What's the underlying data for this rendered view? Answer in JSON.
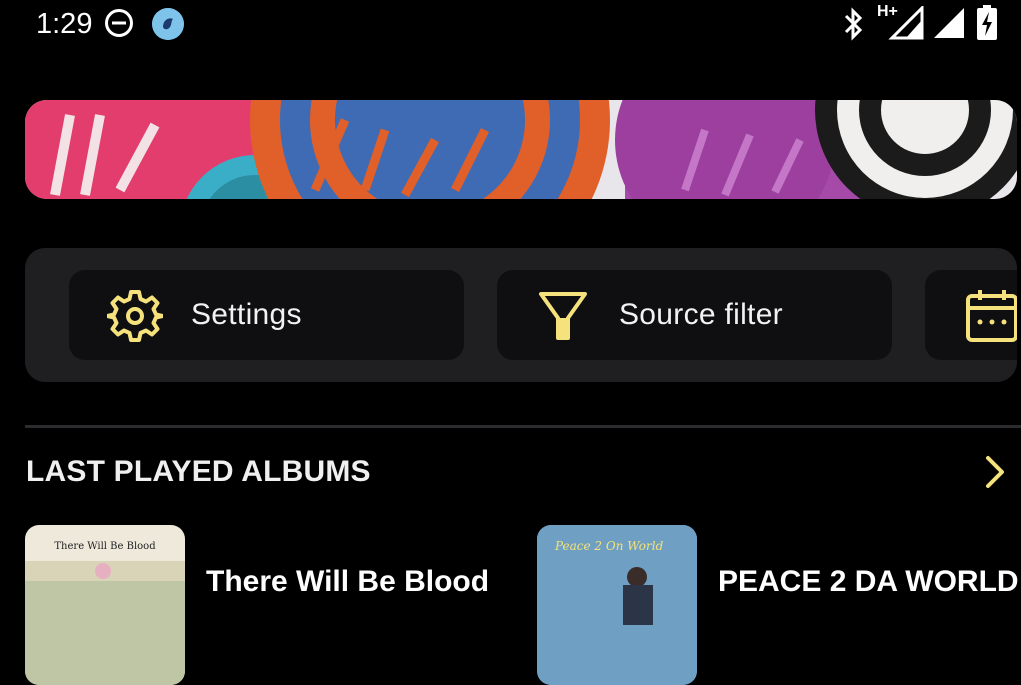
{
  "status_bar": {
    "time": "1:29",
    "network_type": "H+",
    "icons": [
      "do-not-disturb-icon",
      "app-notification-icon",
      "bluetooth-icon",
      "cell-signal-icon",
      "wifi-signal-icon",
      "battery-charging-icon"
    ]
  },
  "banner": {
    "icon": "collage-banner"
  },
  "shortcuts": {
    "settings_label": "Settings",
    "source_filter_label": "Source filter",
    "icons": [
      "gear-icon",
      "filter-icon",
      "calendar-icon"
    ]
  },
  "last_played": {
    "title": "LAST PLAYED ALBUMS",
    "albums": [
      {
        "title": "There Will Be Blood",
        "cover_text": "There Will Be Blood"
      },
      {
        "title": "PEACE 2 DA WORLD",
        "cover_text": "Peace 2 On World"
      }
    ]
  },
  "colors": {
    "accent": "#f6e27c",
    "background": "#000000",
    "card": "#1f1f22",
    "chip": "#0f0f12"
  }
}
